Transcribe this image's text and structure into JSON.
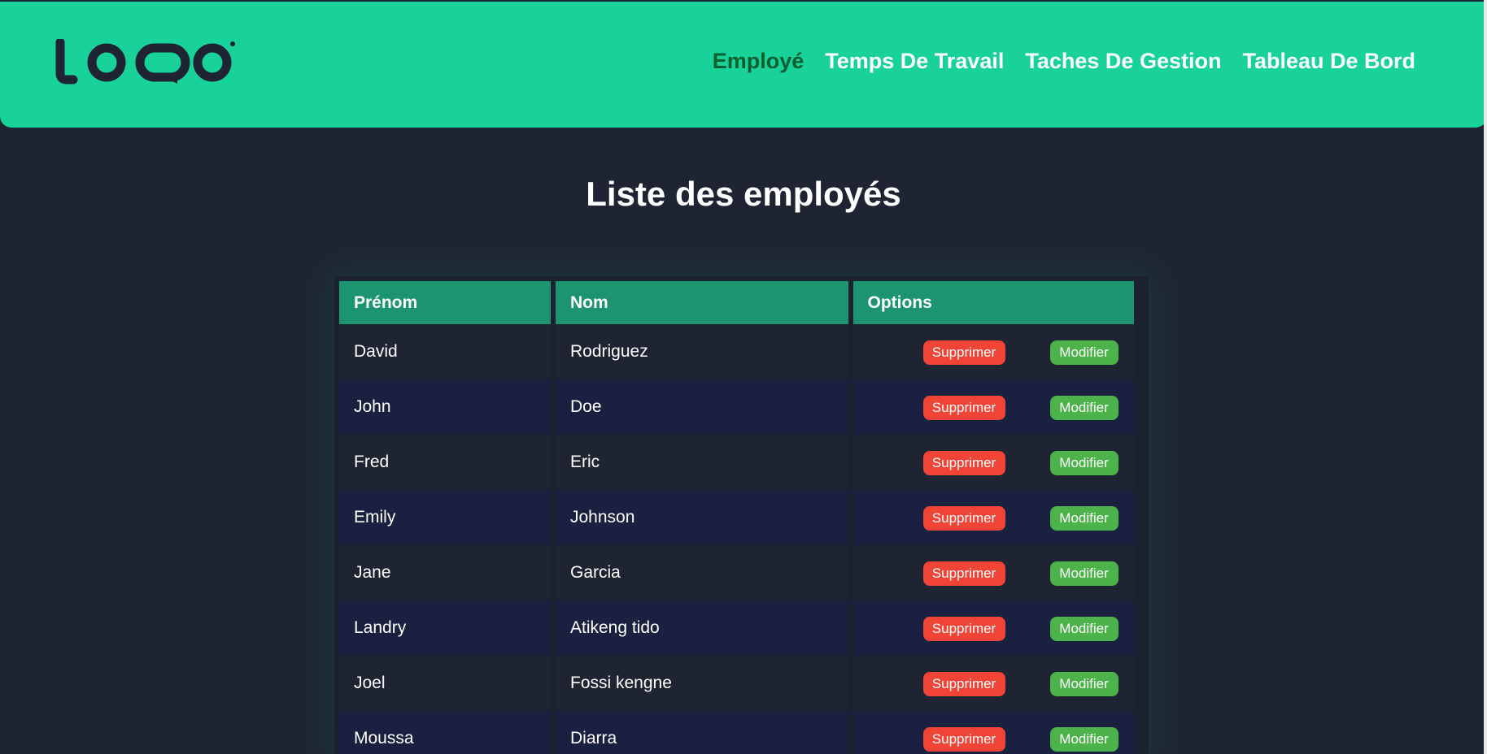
{
  "nav": {
    "items": [
      {
        "label": "Employé",
        "active": true
      },
      {
        "label": "Temps De Travail",
        "active": false
      },
      {
        "label": "Taches De Gestion",
        "active": false
      },
      {
        "label": "Tableau De Bord",
        "active": false
      }
    ]
  },
  "page": {
    "title": "Liste des employés"
  },
  "table": {
    "headers": [
      "Prénom",
      "Nom",
      "Options"
    ],
    "delete_label": "Supprimer",
    "edit_label": "Modifier",
    "rows": [
      {
        "prenom": "David",
        "nom": "Rodriguez"
      },
      {
        "prenom": "John",
        "nom": "Doe"
      },
      {
        "prenom": "Fred",
        "nom": "Eric"
      },
      {
        "prenom": "Emily",
        "nom": "Johnson"
      },
      {
        "prenom": "Jane",
        "nom": "Garcia"
      },
      {
        "prenom": "Landry",
        "nom": "Atikeng tido"
      },
      {
        "prenom": "Joel",
        "nom": "Fossi kengne"
      },
      {
        "prenom": "Moussa",
        "nom": "Diarra"
      }
    ]
  },
  "colors": {
    "header_bg": "#18d29a",
    "page_bg": "#1f2433",
    "table_header_bg": "#1d9470",
    "delete_button": "#f04437",
    "edit_button": "#4cb24a",
    "active_nav": "#0d5e2e"
  }
}
